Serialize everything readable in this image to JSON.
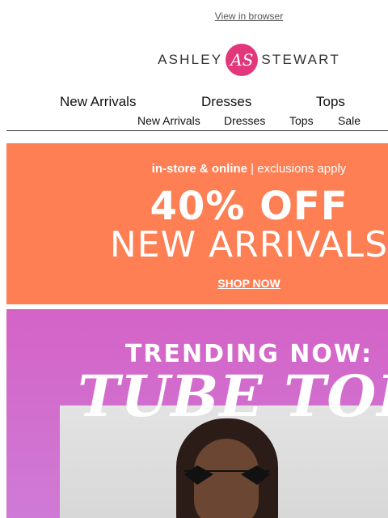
{
  "header": {
    "view_in_browser": "View in browser",
    "brand_left": "ASHLEY",
    "brand_right": "STEWART",
    "brand_mark": "AS"
  },
  "nav_primary": [
    "New Arrivals",
    "Dresses",
    "Tops"
  ],
  "nav_secondary": [
    "New Arrivals",
    "Dresses",
    "Tops",
    "Sale"
  ],
  "promo": {
    "line1_bold": "in-store & online",
    "line1_sep": " | ",
    "line1_light": "exclusions apply",
    "headline": "40% OFF",
    "subhead": "NEW ARRIVALS",
    "cta": "SHOP NOW",
    "background": "#fd7f53"
  },
  "trending": {
    "eyebrow": "TRENDING NOW:",
    "title": "TUBE TOP",
    "background": "#d463c6"
  },
  "colors": {
    "brand_pink": "#e2377a",
    "text": "#111111"
  }
}
